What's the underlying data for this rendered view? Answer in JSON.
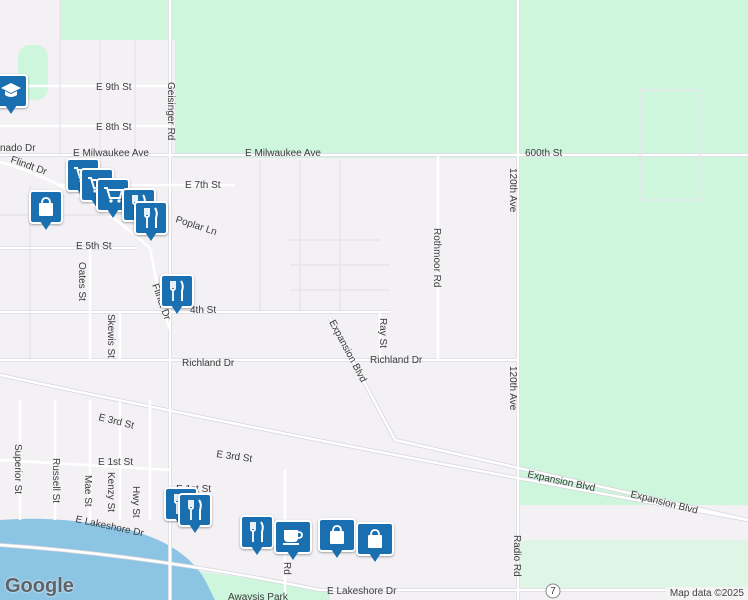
{
  "map": {
    "colors": {
      "land": "#f3f1f4",
      "park": "#cdf6dd",
      "water": "#8cc4e4",
      "road": "#ffffff",
      "road_edge": "#d7d5dc",
      "pin": "#1a6fb0"
    },
    "roads": {
      "e_9th_st": "E 9th St",
      "e_8th_st": "E 8th St",
      "e_milwaukee_ave": "E Milwaukee Ave",
      "e_milwaukee_ave_2": "E Milwaukee Ave",
      "600th_st": "600th St",
      "e_7th_st": "E 7th St",
      "poplar_ln": "Poplar Ln",
      "e_5th_st": "E 5th St",
      "fourth_st": "4th St",
      "flindt_dr": "Flindt Dr",
      "flindt_dr_2": "Flindt Dr",
      "geisinger_rd": "Geisinger Rd",
      "rothmoor_rd": "Rothmoor Rd",
      "120th_ave": "120th Ave",
      "120th_ave_2": "120th Ave",
      "oates_st": "Oates St",
      "skewis_st": "Skewis St",
      "expansion_blvd": "Expansion Blvd",
      "expansion_blvd_2": "Expansion Blvd",
      "expansion_blvd_3": "Expansion Blvd",
      "ray_st": "Ray St",
      "richland_dr": "Richland Dr",
      "richland_dr_2": "Richland Dr",
      "e_3rd_st": "E 3rd St",
      "e_3rd_st_2": "E 3rd St",
      "e_1st_st": "E 1st St",
      "e_1st_st_2": "E 1st St",
      "superior_st": "Superior St",
      "russell_st": "Russell St",
      "mae_st": "Mae St",
      "kenzy_st": "Kenzy St",
      "hwy_st": "Hwy St",
      "radio_rd": "Radio Rd",
      "e_lakeshore_dr": "E Lakeshore Dr",
      "e_lakeshore_dr_2": "E Lakeshore Dr",
      "tornado_dr": "nado Dr",
      "partial_rd": "Rd",
      "partial_m": "M"
    },
    "shield": "7",
    "park_name": "Awaysis Park",
    "google": "Google",
    "attribution": "Map data ©2025"
  },
  "markers": [
    {
      "icon": "school-icon"
    },
    {
      "icon": "grocery-cart-icon"
    },
    {
      "icon": "grocery-cart-icon"
    },
    {
      "icon": "grocery-cart-icon"
    },
    {
      "icon": "shopping-bag-icon"
    },
    {
      "icon": "restaurant-icon"
    },
    {
      "icon": "restaurant-icon"
    },
    {
      "icon": "restaurant-icon"
    },
    {
      "icon": "restaurant-icon"
    },
    {
      "icon": "restaurant-icon"
    },
    {
      "icon": "cafe-icon"
    },
    {
      "icon": "shopping-bag-icon"
    },
    {
      "icon": "shopping-bag-icon"
    }
  ]
}
